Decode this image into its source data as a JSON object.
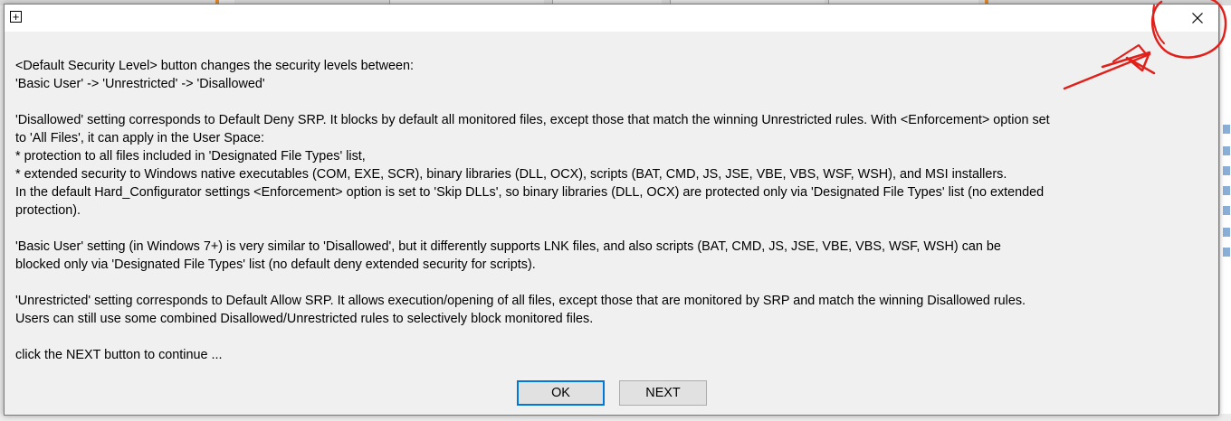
{
  "dialog": {
    "system_menu_glyph": "+",
    "close_glyph": "✕",
    "paragraphs": [
      [
        "<Default Security Level> button changes the security levels between:",
        "'Basic User' -> 'Unrestricted' -> 'Disallowed'"
      ],
      [
        "'Disallowed' setting corresponds to Default Deny SRP. It blocks by default all monitored files, except those that match the winning Unrestricted rules. With <Enforcement> option set",
        "to 'All Files', it can apply in the User Space:",
        "* protection to all files included in 'Designated File Types' list,",
        "* extended security to Windows native executables (COM, EXE, SCR), binary libraries (DLL, OCX), scripts (BAT, CMD, JS, JSE, VBE, VBS, WSF, WSH), and MSI installers.",
        "In the default Hard_Configurator settings <Enforcement> option is set to 'Skip DLLs', so binary libraries (DLL, OCX) are protected only via 'Designated File Types' list (no extended",
        "protection)."
      ],
      [
        "'Basic User' setting (in Windows 7+) is very similar to 'Disallowed', but it differently supports LNK files, and also scripts (BAT, CMD, JS, JSE, VBE, VBS, WSF, WSH) can be",
        "blocked only via 'Designated File Types' list (no default deny extended security for scripts)."
      ],
      [
        "'Unrestricted' setting corresponds to Default Allow SRP. It allows execution/opening of all files, except those that are monitored by SRP and match the winning Disallowed rules.",
        "Users can still use some combined Disallowed/Unrestricted rules to selectively block monitored files."
      ],
      [
        "click the NEXT button to continue ..."
      ]
    ],
    "buttons": {
      "ok": "OK",
      "next": "NEXT"
    }
  },
  "colors": {
    "annotation_red": "#e0201b",
    "focus_blue": "#0078d7"
  }
}
